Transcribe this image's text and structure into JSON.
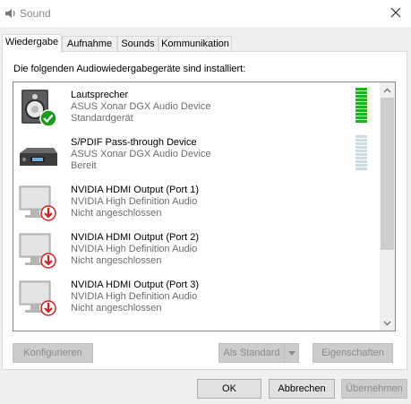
{
  "window": {
    "title": "Sound",
    "close_icon": "close-icon"
  },
  "tabs": [
    {
      "label": "Wiedergabe",
      "active": true
    },
    {
      "label": "Aufnahme",
      "active": false
    },
    {
      "label": "Sounds",
      "active": false
    },
    {
      "label": "Kommunikation",
      "active": false
    }
  ],
  "panel": {
    "heading": "Die folgenden Audiowiedergabegeräte sind installiert:"
  },
  "devices": [
    {
      "name": "Lautsprecher",
      "driver": "ASUS Xonar DGX Audio Device",
      "status": "Standardgerät",
      "icon": "speaker-icon",
      "badge": "default-check-icon",
      "meter": "active"
    },
    {
      "name": "S/PDIF Pass-through Device",
      "driver": "ASUS Xonar DGX Audio Device",
      "status": "Bereit",
      "icon": "spdif-device-icon",
      "meter": "idle"
    },
    {
      "name": "NVIDIA HDMI Output (Port 1)",
      "driver": "NVIDIA High Definition Audio",
      "status": "Nicht angeschlossen",
      "icon": "monitor-icon",
      "badge": "disconnected-arrow-icon"
    },
    {
      "name": "NVIDIA HDMI Output (Port 2)",
      "driver": "NVIDIA High Definition Audio",
      "status": "Nicht angeschlossen",
      "icon": "monitor-icon",
      "badge": "disconnected-arrow-icon"
    },
    {
      "name": "NVIDIA HDMI Output (Port 3)",
      "driver": "NVIDIA High Definition Audio",
      "status": "Nicht angeschlossen",
      "icon": "monitor-icon",
      "badge": "disconnected-arrow-icon"
    }
  ],
  "buttons": {
    "configure": "Konfigurieren",
    "set_default": "Als Standard",
    "properties": "Eigenschaften",
    "ok": "OK",
    "cancel": "Abbrechen",
    "apply": "Übernehmen"
  },
  "colors": {
    "meter_active": "#1db31d",
    "meter_idle": "#c9dbe6",
    "check": "#1a9a1a",
    "arrow_badge": "#d32020"
  }
}
